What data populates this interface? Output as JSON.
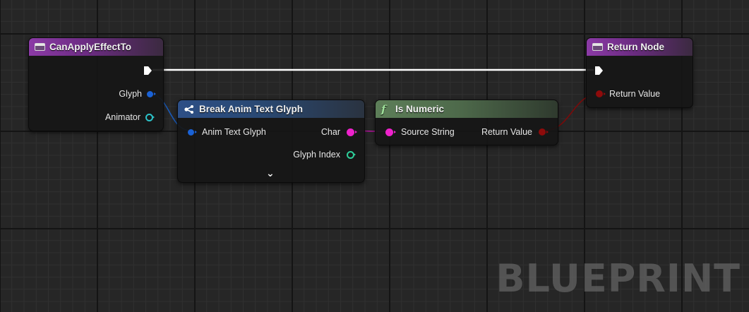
{
  "nodes": {
    "can_apply": {
      "title": "CanApplyEffectTo",
      "pins": {
        "glyph": "Glyph",
        "animator": "Animator"
      }
    },
    "break_glyph": {
      "title": "Break Anim Text Glyph",
      "pins": {
        "anim_text_glyph": "Anim Text Glyph",
        "char": "Char",
        "glyph_index": "Glyph Index"
      }
    },
    "is_numeric": {
      "title": "Is Numeric",
      "pins": {
        "source_string": "Source String",
        "return_value": "Return Value"
      }
    },
    "return_node": {
      "title": "Return Node",
      "pins": {
        "return_value": "Return Value"
      }
    }
  },
  "watermark": "BLUEPRINT",
  "colors": {
    "struct_pin": "#1a62d6",
    "string_pin": "#ee22cc",
    "bool_pin": "#8e0b0b",
    "object_pin": "#2bc2c8",
    "int_pin": "#2ecf9a",
    "exec_wire": "#ffffff"
  }
}
